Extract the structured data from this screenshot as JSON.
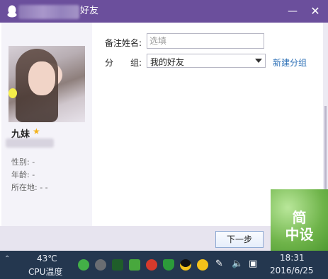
{
  "window": {
    "title": "好友",
    "minimize_glyph": "—",
    "close_glyph": "✕"
  },
  "profile": {
    "nickname": "九妹",
    "gender_label": "性别: -",
    "age_label": "年龄: -",
    "location_label": "所在地: -    -"
  },
  "form": {
    "remark_label": "备注姓名:",
    "remark_placeholder": "选填",
    "remark_value": "",
    "group_label": "分　　组:",
    "group_value": "我的好友",
    "new_group_link": "新建分组"
  },
  "footer": {
    "next_button": "下一步"
  },
  "watermark": {
    "text_line1": "简",
    "text_line2": "中设"
  },
  "taskbar": {
    "cpu_temp": "43℃",
    "cpu_label": "CPU温度",
    "time": "18:31",
    "date": "2016/6/25"
  },
  "colors": {
    "titlebar": "#6b4f9c",
    "accent_link": "#2b6fb6",
    "taskbar": "#24374f"
  },
  "icons": [
    "qq-penguin-icon",
    "star-icon",
    "dropdown-arrow-icon",
    "tray-icons"
  ]
}
